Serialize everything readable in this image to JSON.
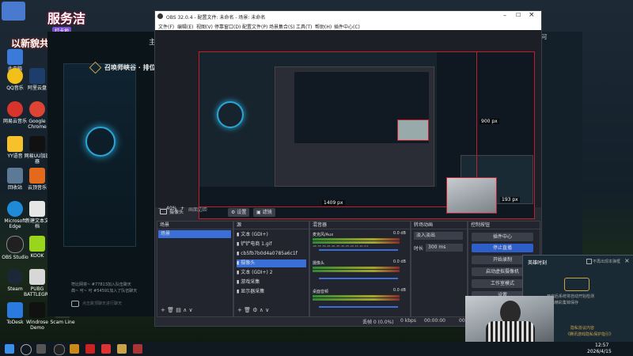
{
  "overlay": {
    "logo_text": "服务洁",
    "banner_text": "以新貌共赴热爱",
    "tag": "打卡地"
  },
  "desktop_icons": [
    {
      "label": "此电脑"
    },
    {
      "label": "QQ音乐"
    },
    {
      "label": "网易云音乐"
    },
    {
      "label": "YY语音"
    },
    {
      "label": "回收站"
    },
    {
      "label": "Microsoft Edge"
    },
    {
      "label": "OBS Studio"
    },
    {
      "label": "Steam"
    },
    {
      "label": "ToDesk"
    },
    {
      "label": "阿里云盘"
    },
    {
      "label": "Google Chrome"
    },
    {
      "label": "网易UU加速器"
    },
    {
      "label": "云顶音乐"
    },
    {
      "label": "新建文本文档"
    },
    {
      "label": "KOOK"
    },
    {
      "label": "PUBG BATTLEGR..."
    },
    {
      "label": "Windrose Demo"
    },
    {
      "label": "Scam Line"
    }
  ],
  "lol": {
    "title": "召唤师峡谷 · 排位",
    "chat1": "符比网将~ #77813加入队伍聊天",
    "chat2": "典~ 可~ 可 #54591加入了队伍聊天",
    "chat_placeholder": "点击跳顶聊天进行聊天",
    "top_char": "主",
    "right_label": "· 可"
  },
  "obs": {
    "title": "OBS 32.0.4 - 配置文件: 未命名 - 场景: 未命名",
    "menu": [
      "文件(F)",
      "编辑(E)",
      "视图(V)",
      "停靠窗口(D)",
      "配置文件(P)",
      "场景集合(S)",
      "工具(T)",
      "帮助(H)",
      "插件中心(C)"
    ],
    "canvas_labels": {
      "height": "900 px",
      "width": "1409 px",
      "small": "193 px"
    },
    "zoom": "40%",
    "zoom_placeholder": "画面边距",
    "toolbar": {
      "source": "摄像头",
      "settings": "设置",
      "filters": "滤镜"
    },
    "docks": {
      "scenes": "场景",
      "sources": "源",
      "mixer": "混音器",
      "transitions": "转场动画",
      "controls": "控制按钮"
    },
    "scenes": [
      "场景"
    ],
    "sources": [
      {
        "name": "文本 (GDI+)"
      },
      {
        "name": "铲铲电商 1.gif"
      },
      {
        "name": "cb5fb7b0d4a0785a6c1f"
      },
      {
        "name": "摄像头"
      },
      {
        "name": "文本 (GDI+) 2"
      },
      {
        "name": "游戏采集"
      },
      {
        "name": "显示器采集"
      }
    ],
    "mixer": [
      {
        "name": "麦克风/Aux",
        "db": "0.0 dB"
      },
      {
        "name": "摄像头",
        "db": "0.0 dB"
      },
      {
        "name": "桌面音频",
        "db": "0.0 dB"
      }
    ],
    "mixer_scale": "-60 -55 -50 -45 -40 -35 -30 -25 -20 -15 -10 -5 0",
    "transitions": {
      "type": "淡入淡出",
      "duration_label": "时长",
      "duration": "300 ms"
    },
    "controls": [
      "插件中心",
      "停止直播",
      "开始录制",
      "启动虚拟摄像机",
      "工作室模式",
      "设置"
    ],
    "status": {
      "dropped": "丢帧 0 (0.0%)",
      "bitrate": "0 kbps",
      "rec": "00:00:00",
      "live": "00:00:00"
    }
  },
  "popup": {
    "title": "英雄时刻",
    "checkbox": "不再出现本弹框",
    "line1": "开启后系统将自动开始检测",
    "line2": "录像精彩集锦保存",
    "link": "隐私协议内容",
    "link2": "《腾讯游戏隐私保护指引》"
  },
  "taskbar": {
    "time": "12:57",
    "date": "2026/4/15"
  },
  "colors": {
    "accent": "#3b6fd8",
    "obs_bg": "#272a33",
    "red": "#c21e2c",
    "live_btn": "#2e5fc9"
  }
}
